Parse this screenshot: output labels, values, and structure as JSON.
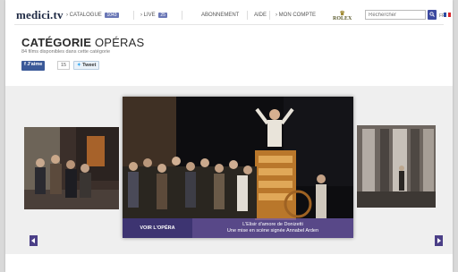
{
  "brand": {
    "logo": "medici.tv"
  },
  "nav": {
    "catalogue": {
      "label": "CATALOGUE",
      "badge": "1043"
    },
    "live": {
      "label": "LIVE",
      "badge": "25"
    },
    "abonnement": "ABONNEMENT",
    "aide": "AIDE",
    "compte": "MON COMPTE",
    "sponsor": "ROLEX",
    "search_placeholder": "Rechercher",
    "language": "FR"
  },
  "heading": {
    "title_bold": "CATÉGORIE",
    "title_light": "OPÉRAS",
    "subtitle": "84 films disponibles dans cette catégorie"
  },
  "social": {
    "like_label": "J'aime",
    "like_count": "15",
    "tweet_label": "Tweet"
  },
  "carousel": {
    "cta": "VOIR L'OPÉRA",
    "caption_line1": "L'Elisir d'amore de Donizetti",
    "caption_line2": "Une mise en scène signée Annabel Arden"
  },
  "colors": {
    "accent": "#4b3f87",
    "nav_badge": "#6a77b6",
    "facebook": "#3b5998"
  }
}
